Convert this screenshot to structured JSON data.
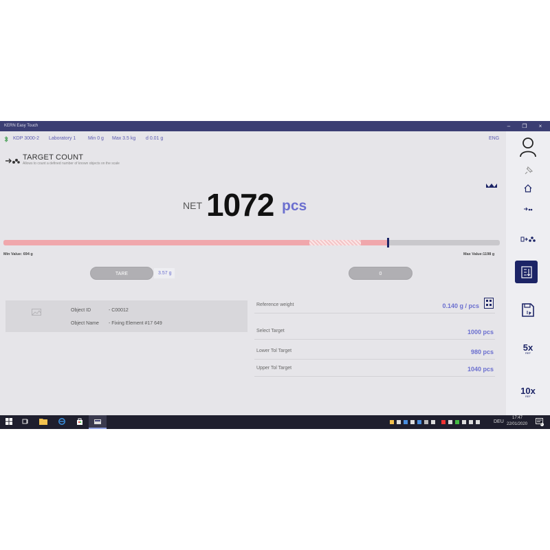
{
  "window": {
    "title": "KERN Easy Touch",
    "minimize": "–",
    "restore": "❐",
    "close": "×"
  },
  "info": {
    "device": "KDP 3000-2",
    "location": "Laboratory 1",
    "min": "Min 0 g",
    "max": "Max 3.5 kg",
    "d": "d 0.01 g",
    "lang": "ENG"
  },
  "mode": {
    "title": "TARGET COUNT",
    "description": "Allows to count a defined number of known objects on the scale"
  },
  "reading": {
    "prefix": "NET",
    "value": "1072",
    "unit": "pcs"
  },
  "progress": {
    "fill_fraction": 0.617,
    "tolerance_start": 0.617,
    "tolerance_end": 0.72,
    "marker_fraction": 0.773,
    "min_label": "Min Value: 694 g",
    "max_label": "Max Value:1198 g"
  },
  "buttons": {
    "tare": "TARE",
    "tare_value": "3.57 g",
    "zero": "0"
  },
  "object": {
    "id_label": "Object ID",
    "id_value": "- C00012",
    "name_label": "Object Name",
    "name_value": "- Fixing Element #17 649"
  },
  "details": {
    "ref_label": "Reference weight",
    "ref_value": "0.140  g / pcs",
    "target_label": "Select Target",
    "target_value": "1000 pcs",
    "lower_label": "Lower Tol Target",
    "lower_value": "980 pcs",
    "upper_label": "Upper Tol Target",
    "upper_value": "1040 pcs"
  },
  "sidebar": {
    "ref5": "5x",
    "ref10": "10x",
    "ref_sub": "REF"
  },
  "taskbar": {
    "time": "17:47",
    "date": "22/01/2020",
    "lang": "DEU",
    "notifications": "5"
  },
  "colors": {
    "accent": "#6b6fcf",
    "titlebar": "#3b3e73",
    "active_sidebar": "#1c2466",
    "bar_fill": "#f0a7ac"
  }
}
